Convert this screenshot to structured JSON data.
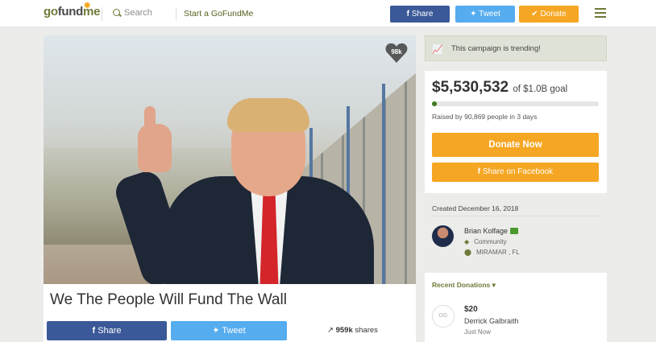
{
  "nav": {
    "logo_go": "go",
    "logo_fund": "fund",
    "logo_me": "me",
    "search_placeholder": "Search",
    "start_link": "Start a GoFundMe",
    "share_label": "Share",
    "tweet_label": "Tweet",
    "donate_label": "Donate"
  },
  "campaign": {
    "hearts": "98k",
    "title": "We The People Will Fund The Wall",
    "share_label": "Share",
    "tweet_label": "Tweet",
    "shares_count": "959k",
    "shares_suffix": " shares"
  },
  "sidebar": {
    "trending_text": "This campaign is trending!",
    "raised": "$5,530,532",
    "goal_text": "of $1.0B goal",
    "progress_fraction": 0.0055,
    "raised_by": "Raised by 90,869 people in 3 days",
    "donate_now": "Donate Now",
    "share_facebook": "Share on Facebook",
    "created": "Created December 16, 2018",
    "organizer_name": "Brian Kolfage",
    "organizer_category": "Community",
    "organizer_location": "MIRAMAR , FL",
    "recent_label": "Recent Donations",
    "donation_amount": "$20",
    "donor_name": "Derrick Galbraith",
    "donation_time": "Just Now",
    "donor_initials": "DG"
  },
  "colors": {
    "facebook": "#3b5998",
    "twitter": "#55acee",
    "donate": "#f5a623",
    "brand_green": "#6f7a3a"
  }
}
